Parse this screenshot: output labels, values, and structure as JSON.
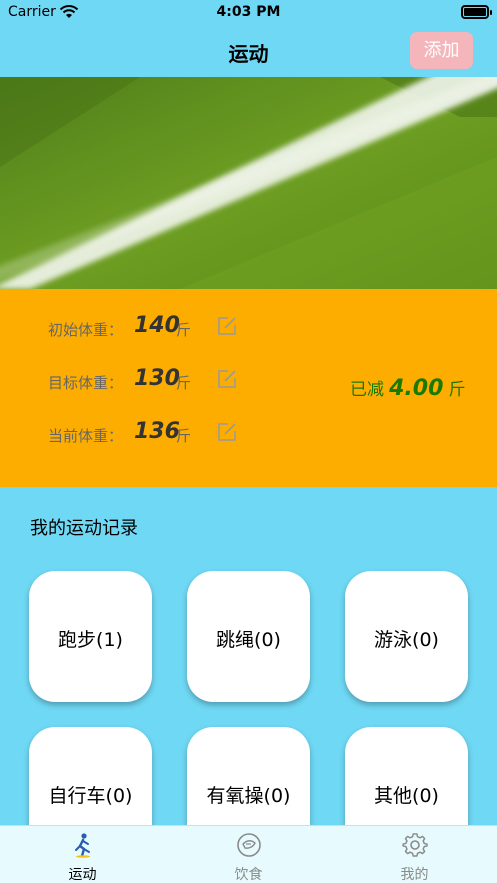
{
  "status_bar": {
    "carrier": "Carrier",
    "time": "4:03 PM"
  },
  "navbar": {
    "title": "运动",
    "add_label": "添加"
  },
  "weights": {
    "initial": {
      "label": "初始体重：",
      "value": "140",
      "unit": "斤"
    },
    "target": {
      "label": "目标体重：",
      "value": "130",
      "unit": "斤"
    },
    "current": {
      "label": "当前体重：",
      "value": "136",
      "unit": "斤"
    },
    "lost": {
      "label": "已减",
      "value": "4.00",
      "unit": "斤"
    }
  },
  "records": {
    "title": "我的运动记录",
    "items": [
      {
        "label": "跑步(1)"
      },
      {
        "label": "跳绳(0)"
      },
      {
        "label": "游泳(0)"
      },
      {
        "label": "自行车(0)"
      },
      {
        "label": "有氧操(0)"
      },
      {
        "label": "其他(0)"
      }
    ]
  },
  "tabs": [
    {
      "label": "运动",
      "icon": "running-icon",
      "active": true
    },
    {
      "label": "饮食",
      "icon": "food-icon",
      "active": false
    },
    {
      "label": "我的",
      "icon": "gear-icon",
      "active": false
    }
  ],
  "colors": {
    "background": "#6fd8f4",
    "panel": "#fdad00",
    "add_button": "#f4b6bb",
    "lost_text": "#1a7a00",
    "tab_active": "#000000",
    "tab_inactive": "#8a8a8a"
  }
}
